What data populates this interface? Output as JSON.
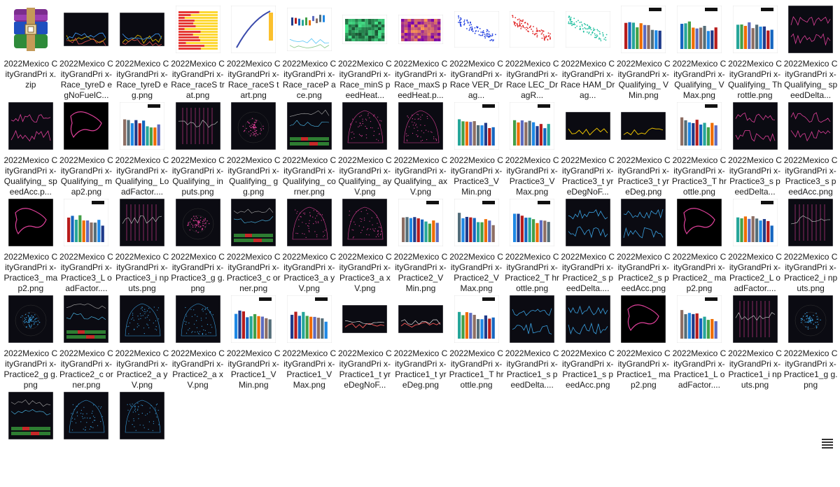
{
  "files": [
    {
      "label": "2022Mexico CityGrandPri x.zip",
      "icon": "zip"
    },
    {
      "label": "2022Mexico CityGrandPri x-Race_tyreD egNoFuelC...",
      "icon": "lines-dark"
    },
    {
      "label": "2022Mexico CityGrandPri x-Race_tyreD eg.png",
      "icon": "lines-dark"
    },
    {
      "label": "2022Mexico CityGrandPri x-Race_raceS trat.png",
      "icon": "strategy"
    },
    {
      "label": "2022Mexico CityGrandPri x-Race_raceS tart.png",
      "icon": "race-start"
    },
    {
      "label": "2022Mexico CityGrandPri x-Race_raceP ace.png",
      "icon": "box-plot"
    },
    {
      "label": "2022Mexico CityGrandPri x-Race_minS peedHeat...",
      "icon": "heat-green"
    },
    {
      "label": "2022Mexico CityGrandPri x-Race_maxS peedHeat.p...",
      "icon": "heat-magma"
    },
    {
      "label": "2022Mexico CityGrandPri x-Race VER_Drag...",
      "icon": "scatter-blue"
    },
    {
      "label": "2022Mexico CityGrandPri x-Race LEC_DragR...",
      "icon": "scatter-red"
    },
    {
      "label": "2022Mexico CityGrandPri x-Race HAM_Drag...",
      "icon": "scatter-teal"
    },
    {
      "label": "2022Mexico CityGrandPri x-Qualifying_ VMin.png",
      "icon": "bars-white"
    },
    {
      "label": "2022Mexico CityGrandPri x-Qualifying_ VMax.png",
      "icon": "bars-white"
    },
    {
      "label": "2022Mexico CityGrandPri x-Qualifying_ Throttle.png",
      "icon": "bars-white"
    },
    {
      "label": "2022Mexico CityGrandPri x-Qualifying_ speedDelta...",
      "icon": "trace-pink"
    },
    {
      "label": "2022Mexico CityGrandPri x-Qualifying_ speedAcc.p...",
      "icon": "trace-pink"
    },
    {
      "label": "2022Mexico CityGrandPri x-Qualifying_ map2.png",
      "icon": "map-dark"
    },
    {
      "label": "2022Mexico CityGrandPri x-Qualifying_ LoadFactor....",
      "icon": "bars-white"
    },
    {
      "label": "2022Mexico CityGrandPri x-Qualifying_ inputs.png",
      "icon": "inputs-dark"
    },
    {
      "label": "2022Mexico CityGrandPri x-Qualifying_ gg.png",
      "icon": "gg-pink"
    },
    {
      "label": "2022Mexico CityGrandPri x-Qualifying_ corner.png",
      "icon": "corner"
    },
    {
      "label": "2022Mexico CityGrandPri x-Qualifying_ ayV.png",
      "icon": "ayv-pink"
    },
    {
      "label": "2022Mexico CityGrandPri x-Qualifying_ axV.png",
      "icon": "axv-pink"
    },
    {
      "label": "2022Mexico CityGrandPri x-Practice3_V Min.png",
      "icon": "bars-white"
    },
    {
      "label": "2022Mexico CityGrandPri x-Practice3_V Max.png",
      "icon": "bars-white"
    },
    {
      "label": "2022Mexico CityGrandPri x-Practice3_t yreDegNoF...",
      "icon": "lines-yellow"
    },
    {
      "label": "2022Mexico CityGrandPri x-Practice3_t yreDeg.png",
      "icon": "lines-yellow"
    },
    {
      "label": "2022Mexico CityGrandPri x-Practice3_T hrottle.png",
      "icon": "bars-white"
    },
    {
      "label": "2022Mexico CityGrandPri x-Practice3_s peedDelta...",
      "icon": "trace-pink"
    },
    {
      "label": "2022Mexico CityGrandPri x-Practice3_s peedAcc.png",
      "icon": "trace-pink"
    },
    {
      "label": "2022Mexico CityGrandPri x-Practice3_ map2.png",
      "icon": "map-dark"
    },
    {
      "label": "2022Mexico CityGrandPri x-Practice3_L oadFactor....",
      "icon": "bars-white"
    },
    {
      "label": "2022Mexico CityGrandPri x-Practice3_i nputs.png",
      "icon": "inputs-dark"
    },
    {
      "label": "2022Mexico CityGrandPri x-Practice3_g g.png",
      "icon": "gg-pink"
    },
    {
      "label": "2022Mexico CityGrandPri x-Practice3_c orner.png",
      "icon": "corner"
    },
    {
      "label": "2022Mexico CityGrandPri x-Practice3_a yV.png",
      "icon": "ayv-pink"
    },
    {
      "label": "2022Mexico CityGrandPri x-Practice3_a xV.png",
      "icon": "axv-pink"
    },
    {
      "label": "2022Mexico CityGrandPri x-Practice2_V Min.png",
      "icon": "bars-white"
    },
    {
      "label": "2022Mexico CityGrandPri x-Practice2_V Max.png",
      "icon": "bars-white"
    },
    {
      "label": "2022Mexico CityGrandPri x-Practice2_T hrottle.png",
      "icon": "bars-white"
    },
    {
      "label": "2022Mexico CityGrandPri x-Practice2_s peedDelta....",
      "icon": "trace-blue"
    },
    {
      "label": "2022Mexico CityGrandPri x-Practice2_s peedAcc.png",
      "icon": "trace-blue"
    },
    {
      "label": "2022Mexico CityGrandPri x-Practice2_ map2.png",
      "icon": "map-dark"
    },
    {
      "label": "2022Mexico CityGrandPri x-Practice2_L oadFactor....",
      "icon": "bars-white"
    },
    {
      "label": "2022Mexico CityGrandPri x-Practice2_i nputs.png",
      "icon": "inputs-dark"
    },
    {
      "label": "2022Mexico CityGrandPri x-Practice2_g g.png",
      "icon": "gg-blue"
    },
    {
      "label": "2022Mexico CityGrandPri x-Practice2_c orner.png",
      "icon": "corner"
    },
    {
      "label": "2022Mexico CityGrandPri x-Practice2_a yV.png",
      "icon": "ayv-blue"
    },
    {
      "label": "2022Mexico CityGrandPri x-Practice2_a xV.png",
      "icon": "axv-blue"
    },
    {
      "label": "2022Mexico CityGrandPri x-Practice1_V Min.png",
      "icon": "bars-white"
    },
    {
      "label": "2022Mexico CityGrandPri x-Practice1_V Max.png",
      "icon": "bars-white"
    },
    {
      "label": "2022Mexico CityGrandPri x-Practice1_t yreDegNoF...",
      "icon": "lines-red"
    },
    {
      "label": "2022Mexico CityGrandPri x-Practice1_t yreDeg.png",
      "icon": "lines-red"
    },
    {
      "label": "2022Mexico CityGrandPri x-Practice1_T hrottle.png",
      "icon": "bars-white"
    },
    {
      "label": "2022Mexico CityGrandPri x-Practice1_s peedDelta....",
      "icon": "trace-blue"
    },
    {
      "label": "2022Mexico CityGrandPri x-Practice1_s peedAcc.png",
      "icon": "trace-blue"
    },
    {
      "label": "2022Mexico CityGrandPri x-Practice1_ map2.png",
      "icon": "map-dark"
    },
    {
      "label": "2022Mexico CityGrandPri x-Practice1_L oadFactor....",
      "icon": "bars-white"
    },
    {
      "label": "2022Mexico CityGrandPri x-Practice1_i nputs.png",
      "icon": "inputs-dark"
    },
    {
      "label": "2022Mexico CityGrandPri x-Practice1_g g.png",
      "icon": "gg-blue"
    },
    {
      "label": "",
      "icon": "corner-blue"
    },
    {
      "label": "",
      "icon": "ayv-blue"
    },
    {
      "label": "",
      "icon": "axv-blue"
    }
  ],
  "colors": {
    "dark_bg": "#0b0b12",
    "pink": "#e0409a",
    "blue": "#3aa0e0",
    "bar_palette": [
      "#1f3a8a",
      "#b71c1c",
      "#1565c0",
      "#26a69a",
      "#43a047",
      "#ef6c00",
      "#5c6bc0",
      "#8d6e63",
      "#546e7a",
      "#1e88e5"
    ]
  },
  "toolbar": {
    "view_icon": "details-view-icon"
  }
}
